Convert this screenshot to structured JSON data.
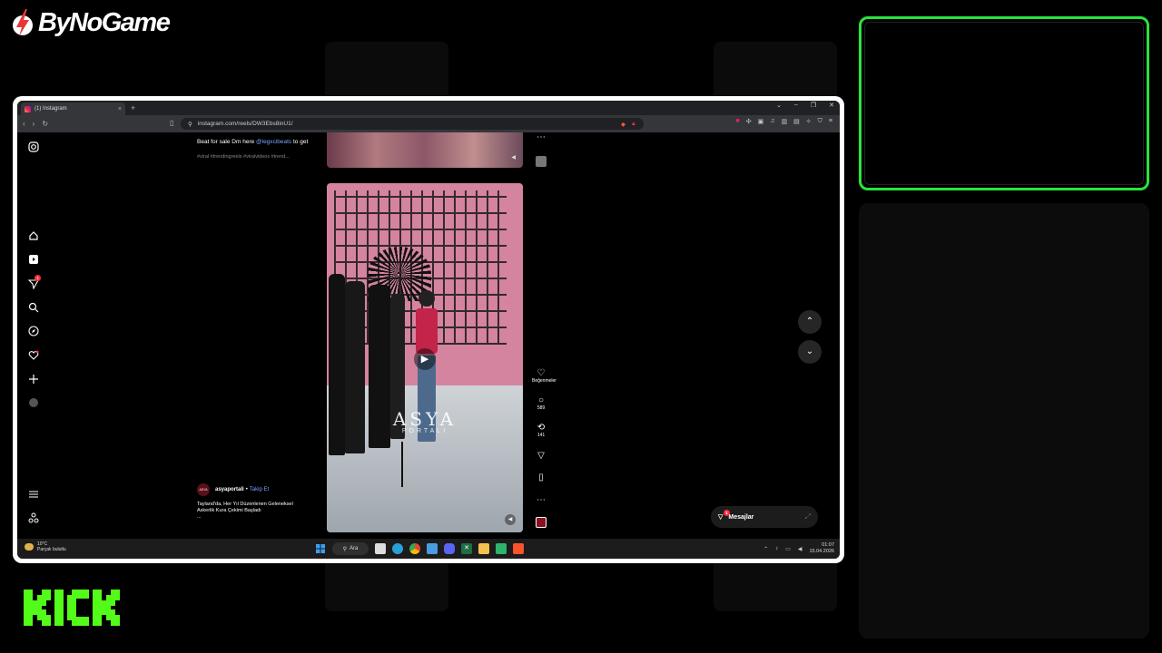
{
  "overlay": {
    "brand_name": "ByNoGame",
    "kick_label": "KICK",
    "accent_color": "#27e43a"
  },
  "browser": {
    "tab_title": "(1) Instagram",
    "tab_close": "×",
    "new_tab": "+",
    "url": "instagram.com/reels/DW3Ebs8inU1/"
  },
  "instagram": {
    "prev_post": {
      "caption_line1": "Beat for sale Dm here",
      "mention": "@legxcibeats",
      "caption_line1_end": "to get",
      "tags": "#viral #trendingreels #viralvideos #trend..."
    },
    "nav_badge": "1",
    "watermark": "ASYA",
    "watermark_sub": "PORTALI",
    "actions": {
      "like_label": "Beğenmeler",
      "comments": "589",
      "reposts": "141"
    },
    "poster": {
      "avatar_text": "ASYA",
      "username": "asyaportali",
      "separator": "•",
      "follow": "Takip Et",
      "desc_line1": "Tayland'da, Her Yıl Düzenlenen Geleneksel",
      "desc_line2": "Askerlik Kura Çekimi Başladı",
      "desc_more": "..."
    },
    "messages": {
      "label": "Mesajlar",
      "badge": "1"
    }
  },
  "taskbar": {
    "weather_temp": "10°C",
    "weather_desc": "Parçalı bulutlu",
    "search_label": "Ara",
    "time": "01:07",
    "date": "15.04.2026"
  }
}
